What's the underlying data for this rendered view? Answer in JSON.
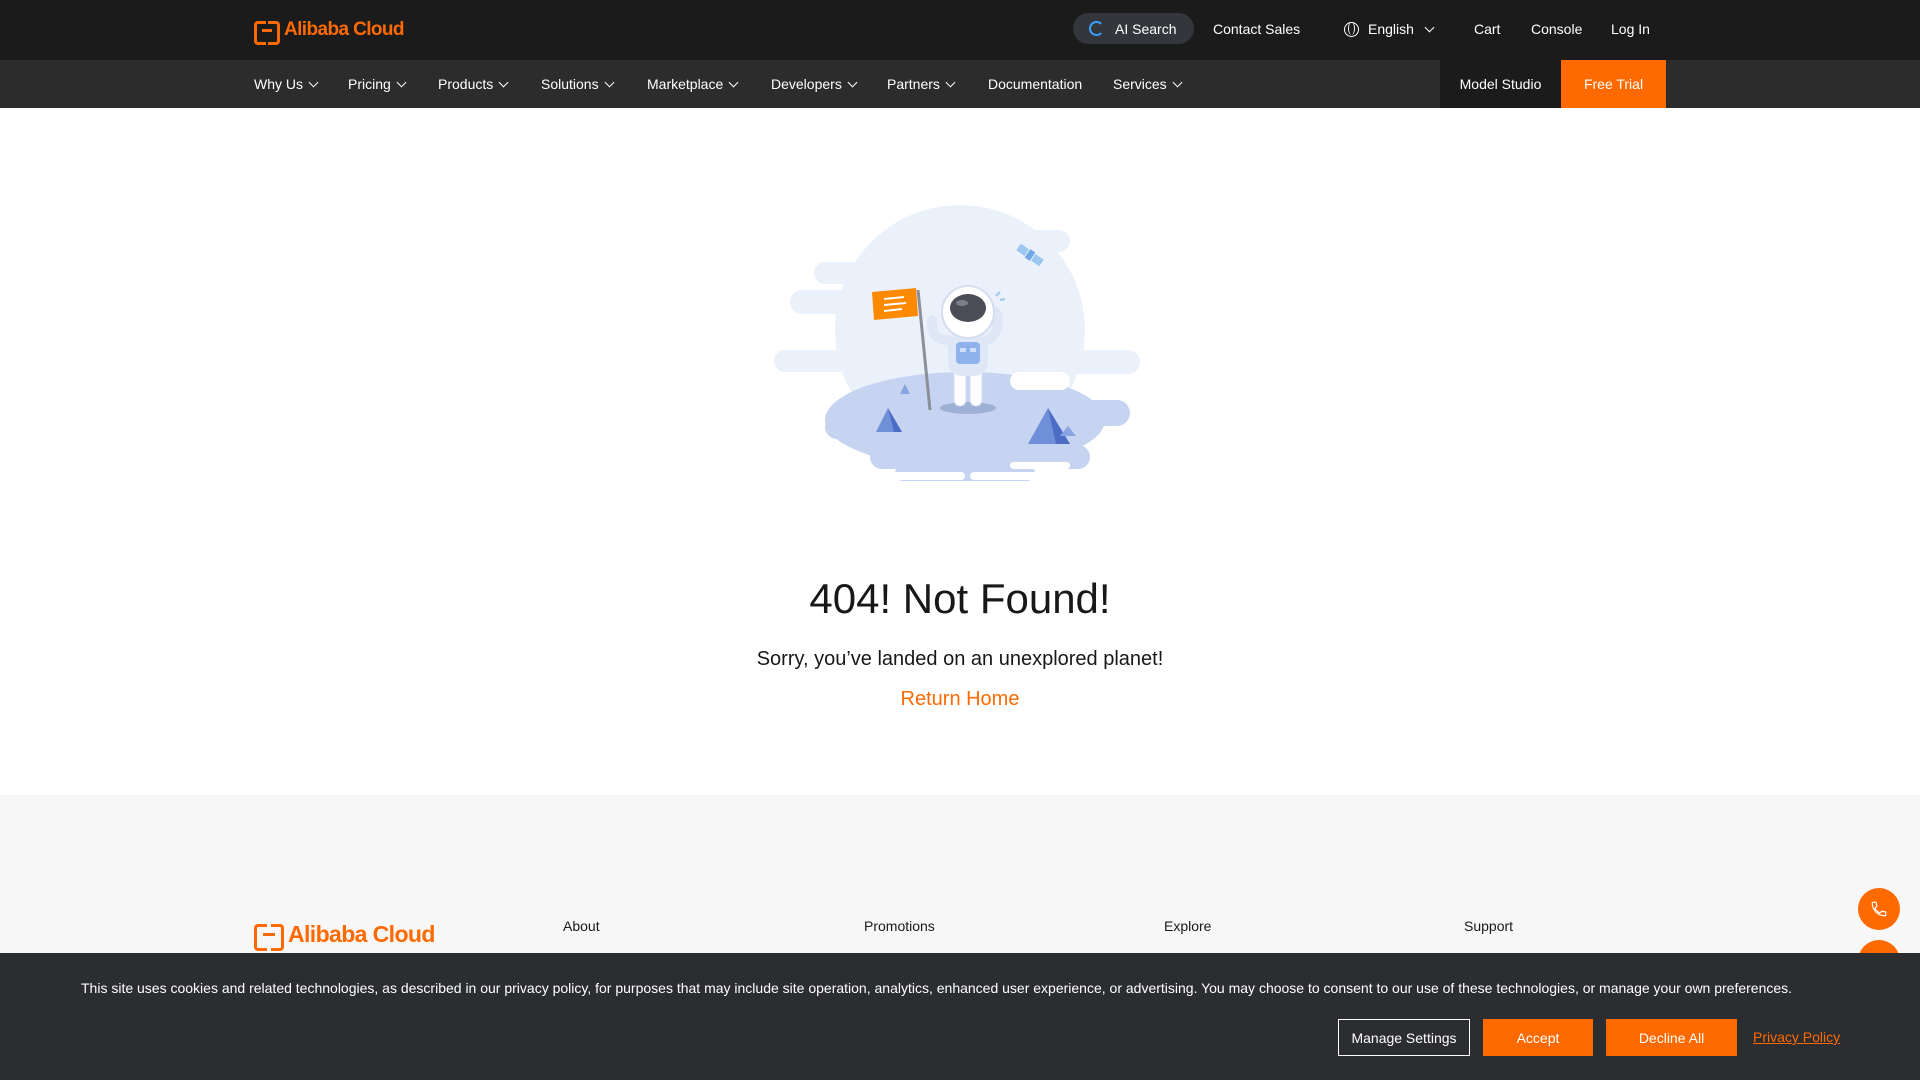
{
  "header": {
    "logo_text": "Alibaba Cloud",
    "ai_search": "AI Search",
    "contact_sales": "Contact Sales",
    "language": "English",
    "cart": "Cart",
    "console": "Console",
    "login": "Log In"
  },
  "nav": {
    "items": [
      {
        "label": "Why Us",
        "dropdown": true
      },
      {
        "label": "Pricing",
        "dropdown": true
      },
      {
        "label": "Products",
        "dropdown": true
      },
      {
        "label": "Solutions",
        "dropdown": true
      },
      {
        "label": "Marketplace",
        "dropdown": true
      },
      {
        "label": "Developers",
        "dropdown": true
      },
      {
        "label": "Partners",
        "dropdown": true
      },
      {
        "label": "Documentation",
        "dropdown": false
      },
      {
        "label": "Services",
        "dropdown": true
      }
    ],
    "model_studio": "Model Studio",
    "free_trial": "Free Trial"
  },
  "main": {
    "title": "404! Not Found!",
    "subtitle": "Sorry, you’ve landed on an unexplored planet!",
    "return_link": "Return Home"
  },
  "footer": {
    "logo_text": "Alibaba Cloud",
    "columns": [
      "About",
      "Promotions",
      "Explore",
      "Support"
    ]
  },
  "cookie": {
    "text": "This site uses cookies and related technologies, as described in our privacy policy, for purposes that may include site operation, analytics, enhanced user experience, or advertising. You may choose to consent to our use of these technologies, or manage your own preferences.",
    "manage": "Manage Settings",
    "accept": "Accept",
    "decline": "Decline All",
    "privacy": "Privacy Policy"
  },
  "colors": {
    "brand": "#ff6a00",
    "topbar": "#1b1b1b",
    "navbar": "#2c2c2c",
    "cookie_bg": "#2b2d30"
  }
}
